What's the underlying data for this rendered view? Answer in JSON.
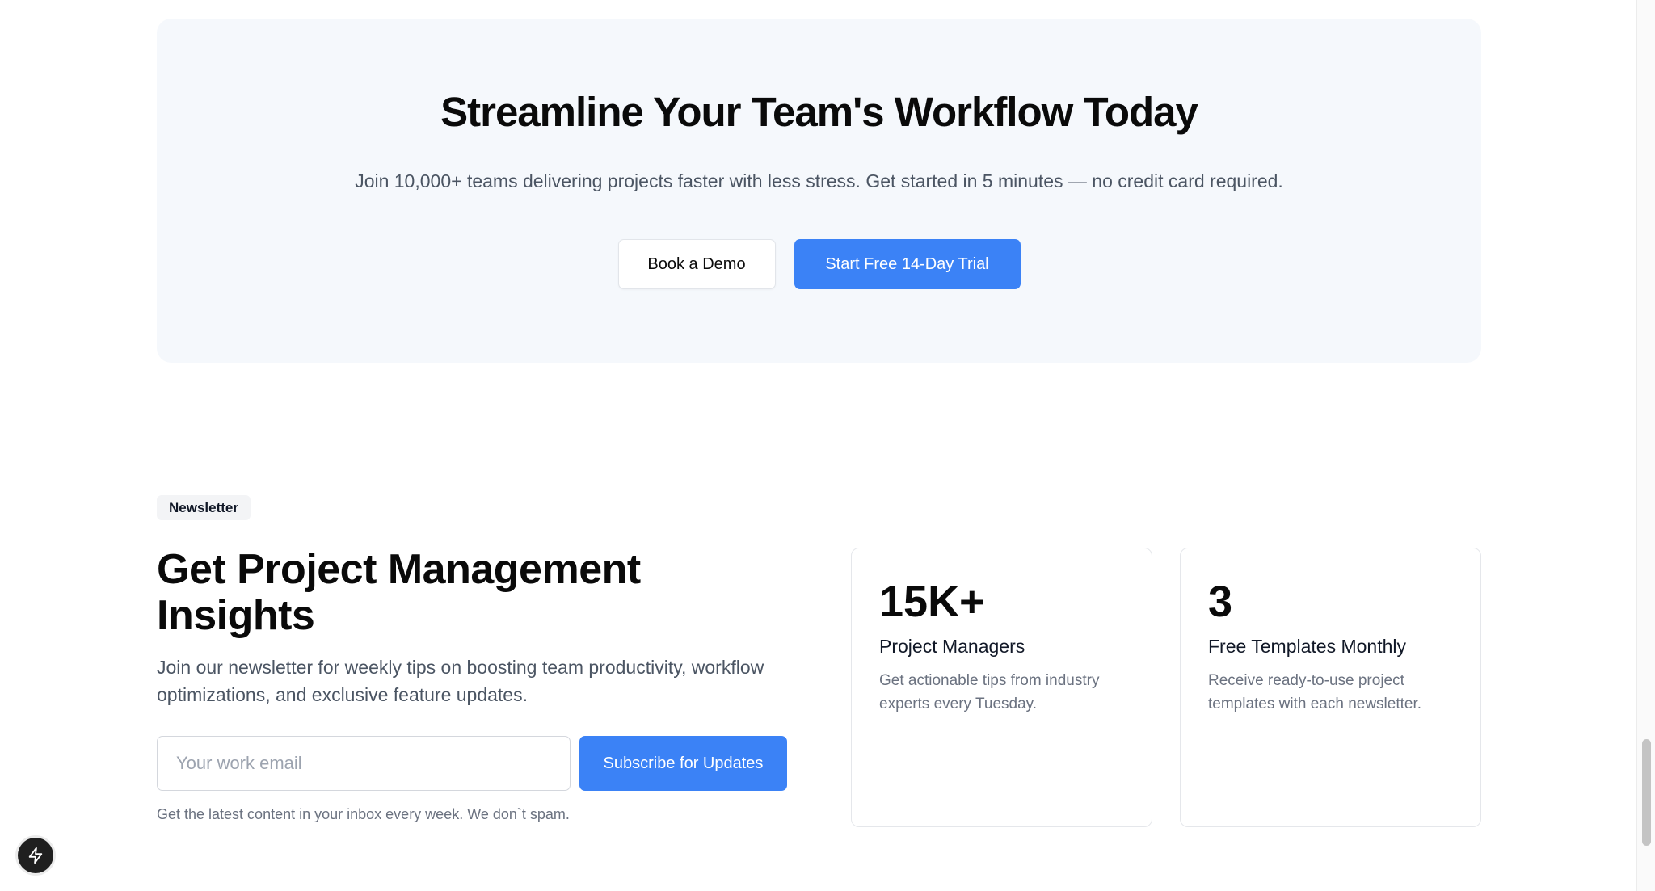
{
  "cta": {
    "title": "Streamline Your Team's Workflow Today",
    "subtitle": "Join 10,000+ teams delivering projects faster with less stress. Get started in 5 minutes — no credit card required.",
    "demo_button": "Book a Demo",
    "trial_button": "Start Free 14-Day Trial"
  },
  "newsletter": {
    "badge": "Newsletter",
    "title": "Get Project Management Insights",
    "description": "Join our newsletter for weekly tips on boosting team productivity, workflow optimizations, and exclusive feature updates.",
    "email_placeholder": "Your work email",
    "email_value": "",
    "subscribe_button": "Subscribe for Updates",
    "note": "Get the latest content in your inbox every week. We don`t spam."
  },
  "stats": [
    {
      "value": "15K+",
      "label": "Project Managers",
      "description": "Get actionable tips from industry experts every Tuesday."
    },
    {
      "value": "3",
      "label": "Free Templates Monthly",
      "description": "Receive ready-to-use project templates with each newsletter."
    }
  ],
  "floating_button": {
    "icon": "lightning-bolt-icon"
  },
  "colors": {
    "accent": "#3b82f6",
    "cta_background": "#f5f8fc",
    "heading": "#0a0a0a",
    "muted_text": "#6b7280"
  }
}
